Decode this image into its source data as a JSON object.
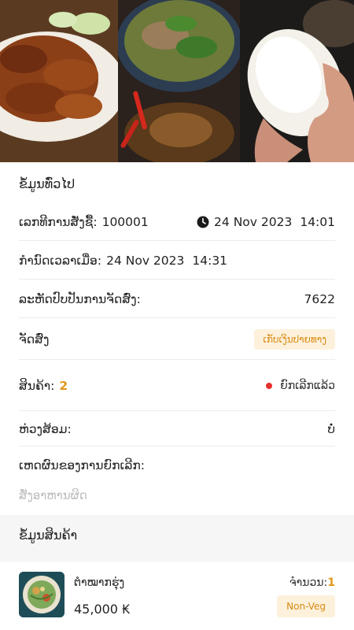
{
  "general": {
    "title": "ຂໍ້ມູນທົ່ວໄປ",
    "order_number_label": "ເລກທີການສັ່ງຊື້:",
    "order_number": "100001",
    "order_date": "24 Nov 2023",
    "order_time": "14:01",
    "scheduled_label": "ກໍານົດເວລາເມື່ອ:",
    "scheduled_date": "24 Nov 2023",
    "scheduled_time": "14:31",
    "order_code_label": "ລະຫັດປົບປັນການຈັດສົ່ງ:",
    "order_code": "7622",
    "delivery_label": "ຈັດສົ່ງ",
    "delivery_badge": "ເກັບເງິນປາຍທາງ",
    "items_label": "ສິນຄ້າ:",
    "items_count": "2",
    "status_text": "ຍົກເລີກແລ້ວ",
    "status_color": "#e5322e",
    "addon_label": "ຫ່ວງສ້ອມ:",
    "addon_value": "ບໍ່",
    "cancel_reason_label": "ເຫດຜົນຂອງການຍົກເລີກ:",
    "cancel_reason_value": "ສັ່ງອາຫານຜິດ"
  },
  "product_info": {
    "title": "ຂໍ້ມູນສິນຄ້າ",
    "items": [
      {
        "name": "ຕໍາໝາກຮຸ່ງ",
        "price": "45,000 ₭",
        "qty_label": "ຈໍານວນ:",
        "qty": "1",
        "badge": "Non-Veg"
      }
    ]
  },
  "colors": {
    "accent": "#e0961c",
    "badge_bg": "#fdf1dc",
    "badge_text": "#d98b12"
  }
}
